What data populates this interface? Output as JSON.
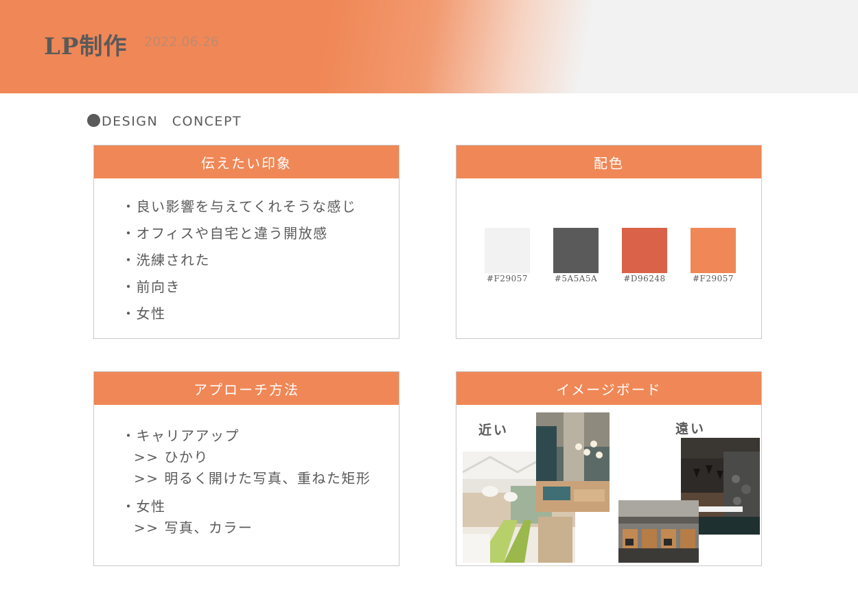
{
  "header": {
    "title": "LP制作",
    "date": "2022.06.26"
  },
  "section": {
    "label": "DESIGN　CONCEPT"
  },
  "impression": {
    "title": "伝えたい印象",
    "items": [
      "・良い影響を与えてくれそうな感じ",
      "・オフィスや自宅と違う開放感",
      "・洗練された",
      "・前向き",
      "・女性"
    ]
  },
  "colors": {
    "title": "配色",
    "swatches": [
      {
        "color": "#F2F2F2",
        "label": "#F29057"
      },
      {
        "color": "#5A5A5A",
        "label": "#5A5A5A"
      },
      {
        "color": "#D96248",
        "label": "#D96248"
      },
      {
        "color": "#F08756",
        "label": "#F29057"
      }
    ]
  },
  "approach": {
    "title": "アプローチ方法",
    "lines": [
      "・キャリアアップ",
      ">> ひかり",
      ">> 明るく開けた写真、重ねた矩形",
      "・女性",
      ">> 写真、カラー"
    ]
  },
  "imageboard": {
    "title": "イメージボード",
    "near": "近い",
    "far": "遠い"
  }
}
